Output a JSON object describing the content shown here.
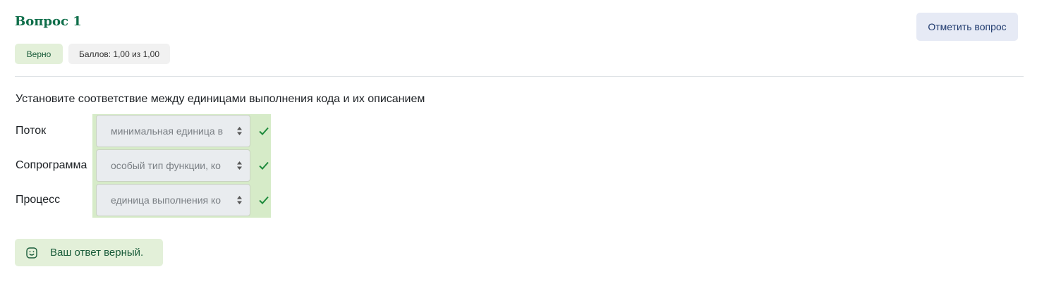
{
  "question": {
    "title": "Вопрос 1",
    "flag_label": "Отметить вопрос",
    "status_badge": "Верно",
    "grade_badge": "Баллов: 1,00 из 1,00",
    "prompt": "Установите соответствие между единицами выполнения кода и их описанием"
  },
  "rows": [
    {
      "label": "Поток",
      "selected": "минимальная единица в",
      "result_icon": "check-icon"
    },
    {
      "label": "Сопрограмма",
      "selected": "особый тип функции, ко",
      "result_icon": "check-icon"
    },
    {
      "label": "Процесс",
      "selected": "единица выполнения ко",
      "result_icon": "check-icon"
    }
  ],
  "feedback": {
    "text": "Ваш ответ верный.",
    "icon": "smile-icon"
  },
  "colors": {
    "accent_green": "#0f6e4a",
    "correct_bg": "#e3f0d9",
    "check_green": "#1e8a3c",
    "flag_bg": "#e6eaf5"
  }
}
